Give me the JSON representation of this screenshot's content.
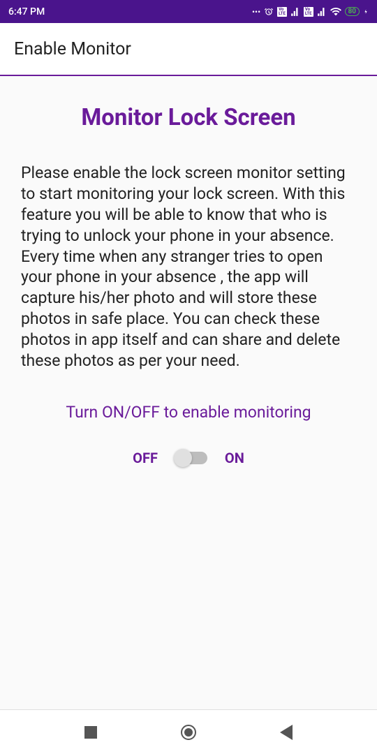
{
  "status": {
    "time": "6:47 PM",
    "battery": "80"
  },
  "appBar": {
    "title": "Enable Monitor"
  },
  "main": {
    "heading": "Monitor Lock Screen",
    "description": "Please enable the lock screen monitor setting to start monitoring your lock screen. With this feature you will be able to know that who is trying to unlock your phone in your absence. Every time when any stranger tries to open your phone in your absence , the app will capture his/her photo and will store these photos in safe place. You can check these photos in app itself and can share and delete these photos as per your need.",
    "toggleLabel": "Turn ON/OFF to enable monitoring",
    "offLabel": "OFF",
    "onLabel": "ON"
  }
}
